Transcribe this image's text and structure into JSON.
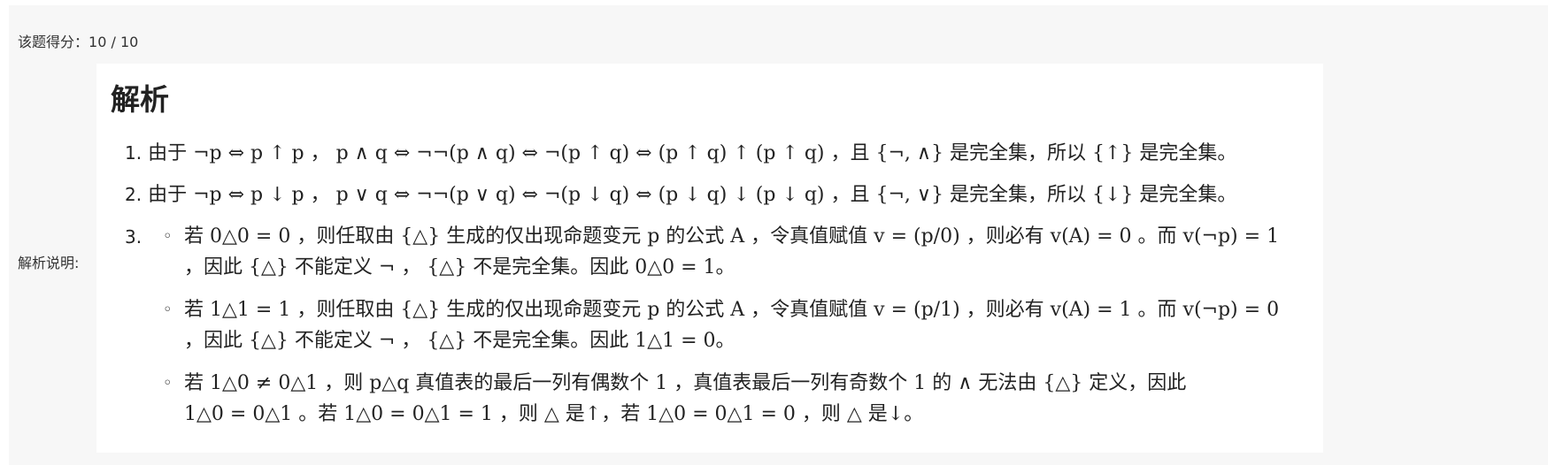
{
  "score": {
    "label": "该题得分：",
    "value": "10 / 10"
  },
  "explanation_label": "解析说明:",
  "card": {
    "title": "解析",
    "items": [
      {
        "number": "1.",
        "text": "由于 ¬p ⇔ p ↑ p ， p ∧ q ⇔ ¬¬(p ∧ q) ⇔ ¬(p ↑ q) ⇔ (p ↑ q) ↑ (p ↑ q) ，且 {¬, ∧} 是完全集，所以 {↑} 是完全集。"
      },
      {
        "number": "2.",
        "text": "由于 ¬p ⇔ p ↓ p ， p ∨ q ⇔ ¬¬(p ∨ q) ⇔ ¬(p ↓ q) ⇔ (p ↓ q) ↓ (p ↓ q) ，且 {¬, ∨} 是完全集，所以 {↓} 是完全集。"
      },
      {
        "number": "3.",
        "bullet": "◦",
        "subitems": [
          {
            "line1": "若 0△0 = 0 ，则任取由 {△} 生成的仅出现命题变元 p 的公式 A ，令真值赋值 v = (p/0) ，则必有 v(A) = 0 。而 v(¬p) = 1",
            "line2": "，因此 {△} 不能定义 ¬ ， {△} 不是完全集。因此 0△0 = 1。"
          },
          {
            "line1": "若 1△1 = 1 ，则任取由 {△} 生成的仅出现命题变元 p 的公式 A ，令真值赋值 v = (p/1) ，则必有 v(A) = 1 。而 v(¬p) = 0",
            "line2": "，因此 {△} 不能定义 ¬ ， {△} 不是完全集。因此 1△1 = 0。"
          },
          {
            "line1": "若 1△0 ≠ 0△1 ，则 p△q 真值表的最后一列有偶数个 1 ，真值表最后一列有奇数个 1 的 ∧ 无法由 {△} 定义，因此",
            "line2": "1△0 = 0△1 。若 1△0 = 0△1 = 1 ，则 △ 是↑，若 1△0 = 0△1 = 0 ，则 △ 是↓。"
          }
        ]
      }
    ]
  }
}
